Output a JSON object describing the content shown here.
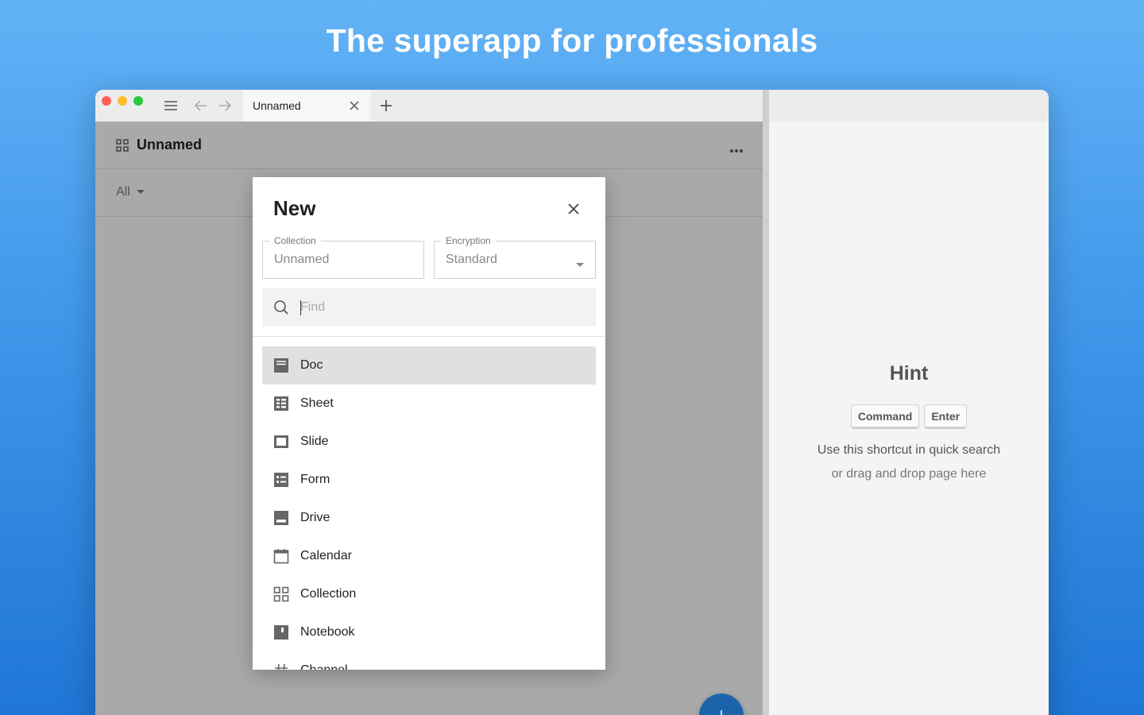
{
  "headline": "The superapp for professionals",
  "window": {
    "tab": {
      "label": "Unnamed"
    }
  },
  "page": {
    "title": "Unnamed",
    "filter": "All"
  },
  "hint": {
    "title": "Hint",
    "keys": [
      "Command",
      "Enter"
    ],
    "line1": "Use this shortcut in quick search",
    "line2": "or drag and drop page here"
  },
  "modal": {
    "title": "New",
    "collection": {
      "legend": "Collection",
      "value": "Unnamed"
    },
    "encryption": {
      "legend": "Encryption",
      "value": "Standard"
    },
    "search": {
      "placeholder": "Find",
      "value": ""
    },
    "items": [
      {
        "label": "Doc",
        "icon": "doc-icon"
      },
      {
        "label": "Sheet",
        "icon": "sheet-icon"
      },
      {
        "label": "Slide",
        "icon": "slide-icon"
      },
      {
        "label": "Form",
        "icon": "form-icon"
      },
      {
        "label": "Drive",
        "icon": "drive-icon"
      },
      {
        "label": "Calendar",
        "icon": "calendar-icon"
      },
      {
        "label": "Collection",
        "icon": "collection-icon"
      },
      {
        "label": "Notebook",
        "icon": "notebook-icon"
      },
      {
        "label": "Channel",
        "icon": "channel-icon"
      }
    ]
  },
  "colors": {
    "accent": "#1b64ac",
    "selected_row": "#e0e0e0",
    "icon": "#666666"
  }
}
